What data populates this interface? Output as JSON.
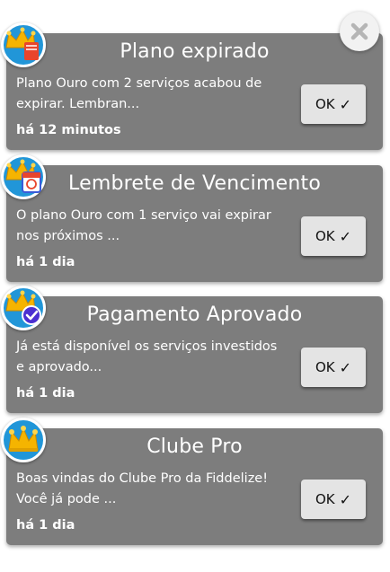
{
  "close": {
    "icon": "close-icon"
  },
  "notifications": [
    {
      "title": "Plano expirado",
      "message": "Plano Ouro com 2 serviços acabou de expirar. Lembran...",
      "time": "há 12 minutos",
      "button": "OK",
      "icon": "crown-expired-icon"
    },
    {
      "title": "Lembrete de Vencimento",
      "message": "O plano Ouro com 1 serviço vai expirar nos próximos ...",
      "time": "há 1 dia",
      "button": "OK",
      "icon": "crown-calendar-icon"
    },
    {
      "title": "Pagamento Aprovado",
      "message": "Já está disponível os serviços investidos e aprovado...",
      "time": "há 1 dia",
      "button": "OK",
      "icon": "crown-check-icon"
    },
    {
      "title": "Clube Pro",
      "message": "Boas vindas do Clube Pro da Fiddelize! Você já pode ...",
      "time": "há 1 dia",
      "button": "OK",
      "icon": "crown-icon"
    }
  ],
  "colors": {
    "card": "#7d7d7d",
    "button": "#e4e4e4",
    "badge": "#2196d8",
    "crown": "#f5b400"
  }
}
